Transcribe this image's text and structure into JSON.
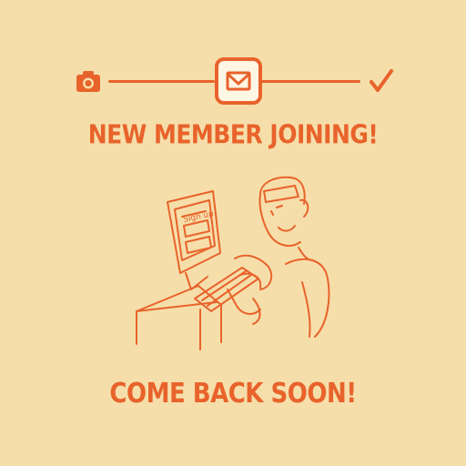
{
  "onboarding": {
    "steps": [
      {
        "icon": "camera-icon",
        "state": "done"
      },
      {
        "icon": "envelope-icon",
        "state": "current"
      },
      {
        "icon": "checkmark-icon",
        "state": "pending"
      }
    ],
    "headline": "NEW MEMBER JOINING!",
    "footer": "COME BACK SOON!",
    "illustration": {
      "subject": "person typing at computer",
      "screen_text": "Sign up"
    }
  },
  "colors": {
    "background": "#F6DEAA",
    "accent": "#E8632B",
    "current_step_fill": "#FFF6E4"
  }
}
